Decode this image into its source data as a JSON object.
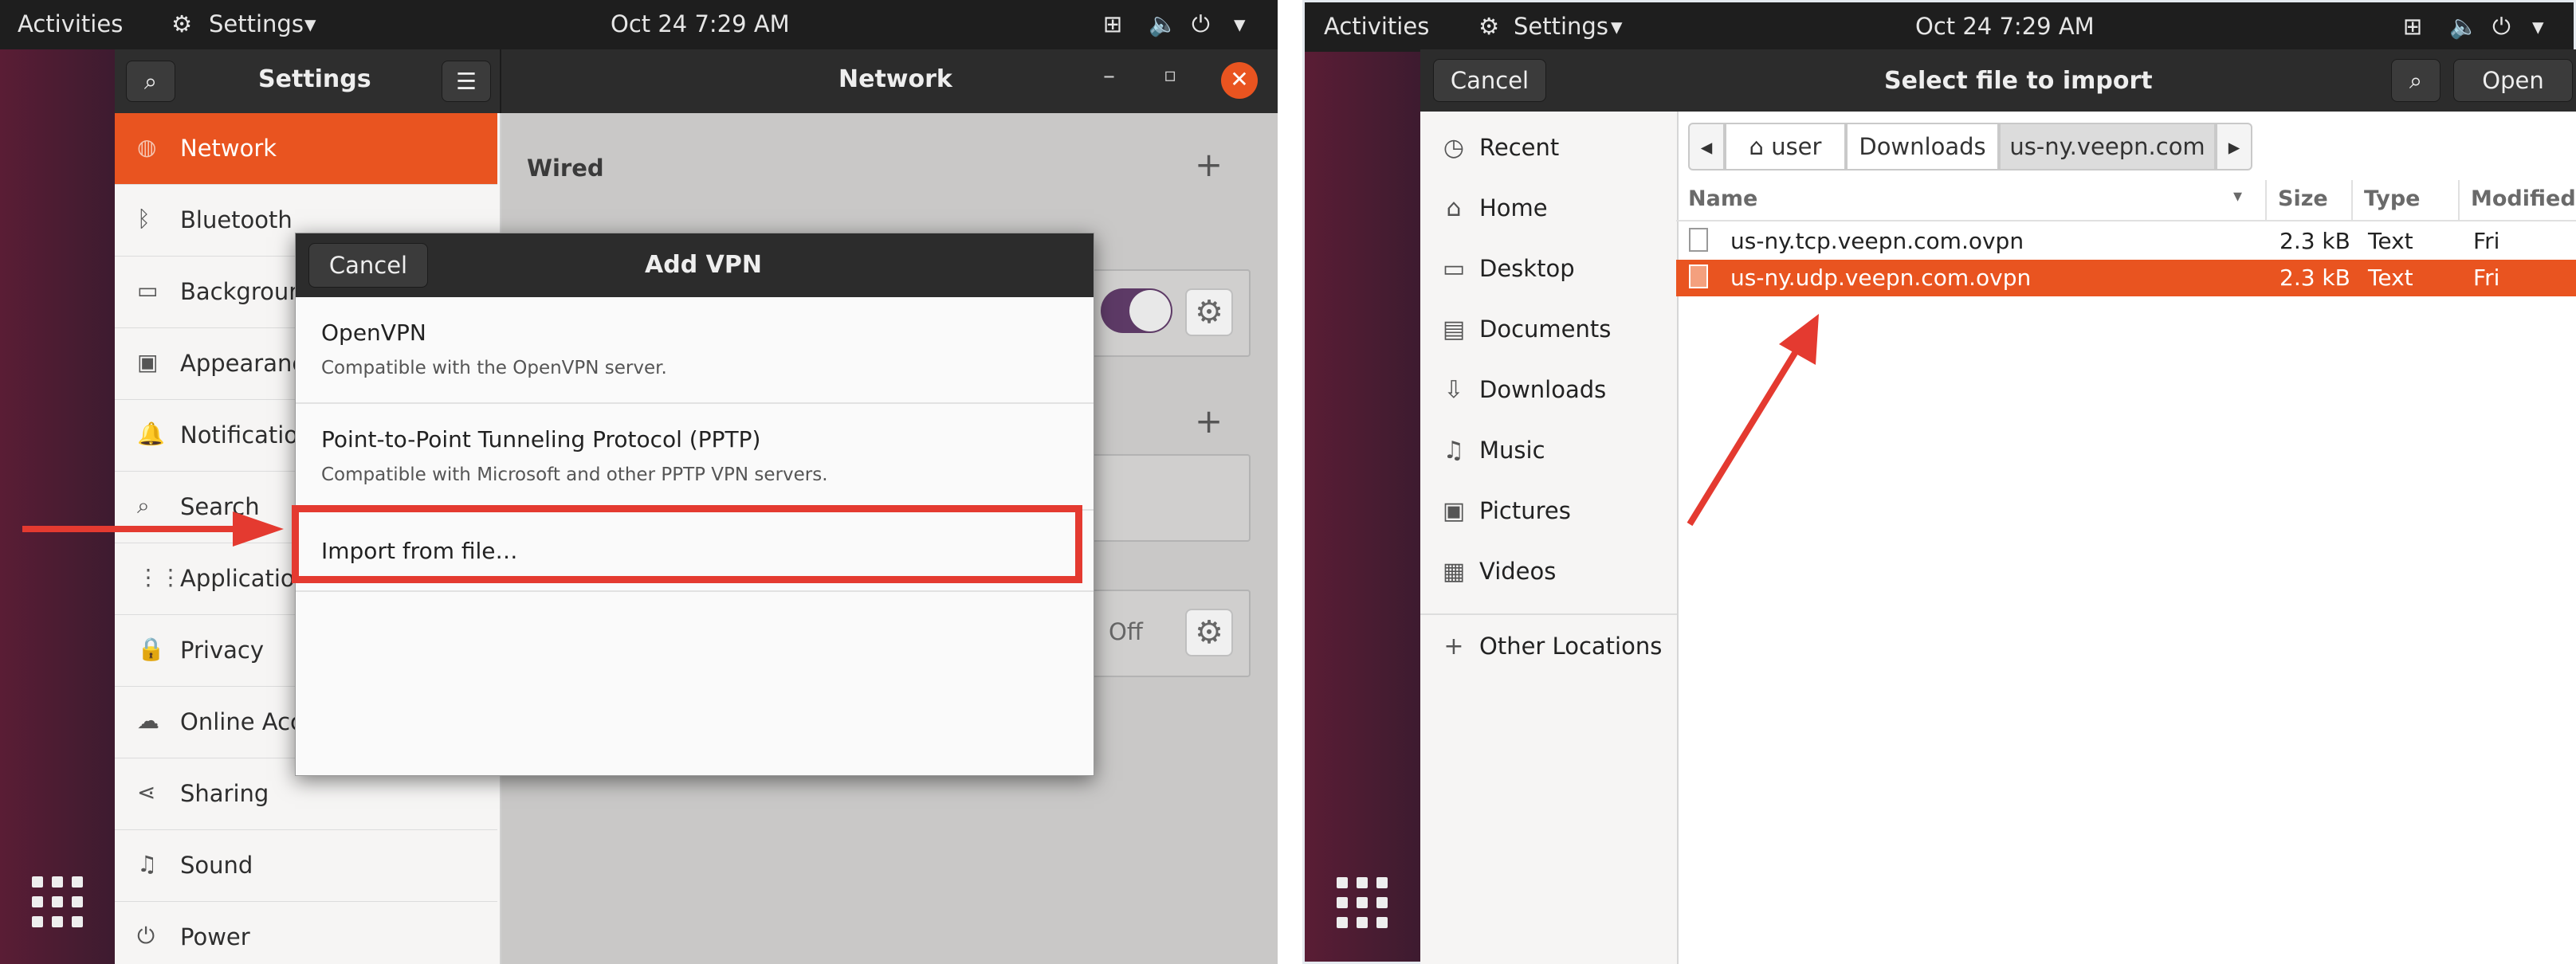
{
  "left": {
    "topbar": {
      "activities": "Activities",
      "app": "Settings",
      "clock": "Oct 24  7:29 AM"
    },
    "settings": {
      "search_icon": "search-icon",
      "title": "Settings",
      "panel_title": "Network",
      "sidebar": [
        {
          "label": "Network",
          "icon": "network-icon",
          "selected": true
        },
        {
          "label": "Bluetooth",
          "icon": "bluetooth-icon"
        },
        {
          "label": "Background",
          "icon": "monitor-icon"
        },
        {
          "label": "Appearance",
          "icon": "appearance-icon"
        },
        {
          "label": "Notifications",
          "icon": "bell-icon"
        },
        {
          "label": "Search",
          "icon": "search-icon"
        },
        {
          "label": "Applications",
          "icon": "apps-icon"
        },
        {
          "label": "Privacy",
          "icon": "lock-icon"
        },
        {
          "label": "Online Accounts",
          "icon": "cloud-icon"
        },
        {
          "label": "Sharing",
          "icon": "share-icon"
        },
        {
          "label": "Sound",
          "icon": "music-icon"
        },
        {
          "label": "Power",
          "icon": "power-icon"
        }
      ],
      "wired_heading": "Wired",
      "proxy_status": "Off"
    },
    "dialog": {
      "cancel": "Cancel",
      "title": "Add VPN",
      "options": [
        {
          "title": "OpenVPN",
          "subtitle": "Compatible with the OpenVPN server."
        },
        {
          "title": "Point-to-Point Tunneling Protocol (PPTP)",
          "subtitle": "Compatible with Microsoft and other PPTP VPN servers."
        },
        {
          "title": "Import from file…",
          "subtitle": ""
        }
      ]
    },
    "accent": "#e95420"
  },
  "right": {
    "topbar": {
      "activities": "Activities",
      "app": "Settings",
      "clock": "Oct 24  7:29 AM"
    },
    "chooser": {
      "cancel": "Cancel",
      "title": "Select file to import",
      "open": "Open",
      "places": [
        {
          "label": "Recent",
          "icon": "clock-icon"
        },
        {
          "label": "Home",
          "icon": "home-icon"
        },
        {
          "label": "Desktop",
          "icon": "desktop-icon"
        },
        {
          "label": "Documents",
          "icon": "document-icon"
        },
        {
          "label": "Downloads",
          "icon": "download-icon"
        },
        {
          "label": "Music",
          "icon": "music-icon"
        },
        {
          "label": "Pictures",
          "icon": "picture-icon"
        },
        {
          "label": "Videos",
          "icon": "video-icon"
        }
      ],
      "other_locations": "Other Locations",
      "path": [
        "user",
        "Downloads",
        "us-ny.veepn.com"
      ],
      "columns": [
        "Name",
        "Size",
        "Type",
        "Modified"
      ],
      "files": [
        {
          "name": "us-ny.tcp.veepn.com.ovpn",
          "size": "2.3 kB",
          "type": "Text",
          "modified": "Fri",
          "selected": false
        },
        {
          "name": "us-ny.udp.veepn.com.ovpn",
          "size": "2.3 kB",
          "type": "Text",
          "modified": "Fri",
          "selected": true
        }
      ]
    }
  }
}
